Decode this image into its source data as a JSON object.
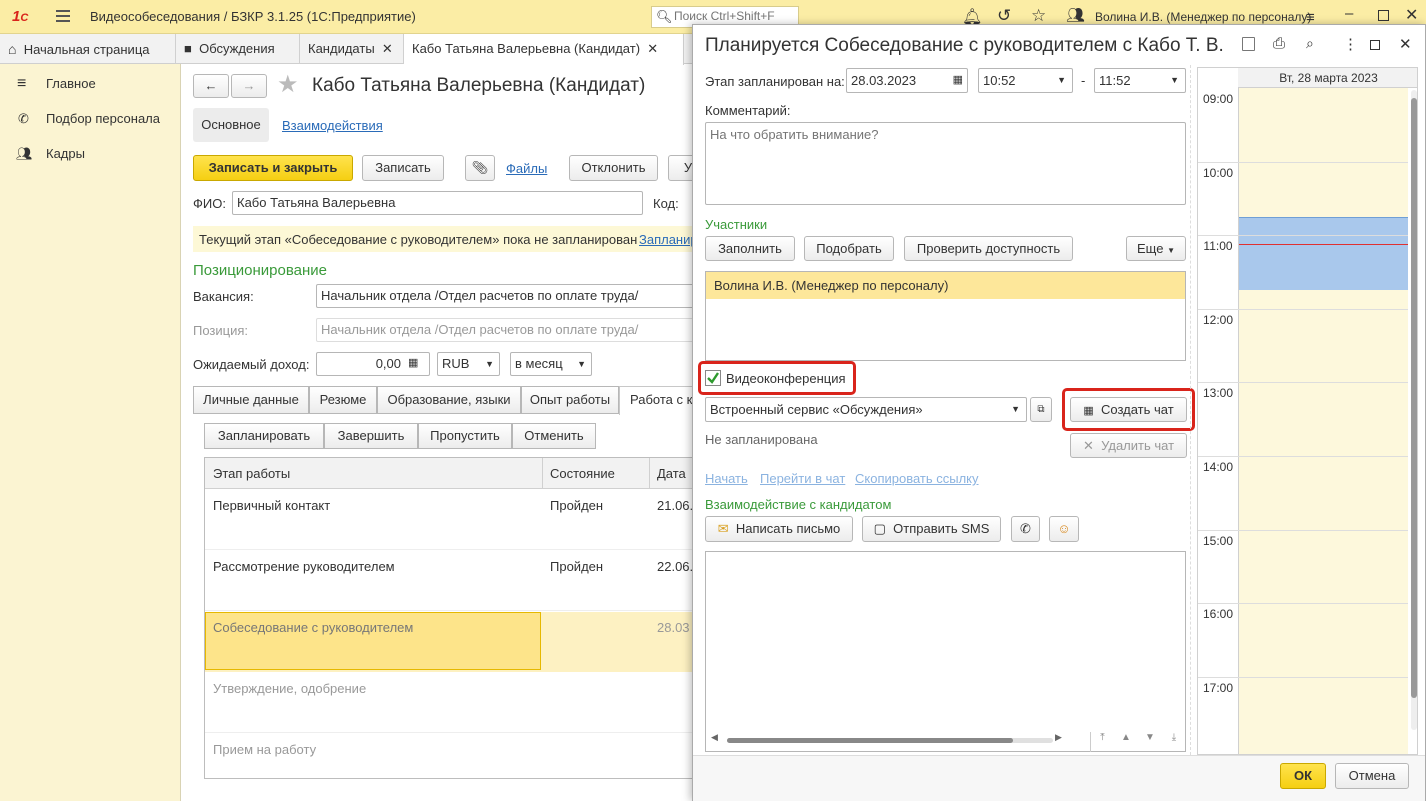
{
  "app": {
    "title": "Видеособеседования / БЗКР 3.1.25  (1С:Предприятие)",
    "search_placeholder": "Поиск Ctrl+Shift+F",
    "user": "Волина И.В. (Менеджер по персоналу)"
  },
  "tabs": [
    "Начальная страница",
    "Обсуждения",
    "Кандидаты",
    "Кабо Татьяна Валерьевна (Кандидат)"
  ],
  "sidebar": {
    "items": [
      "Главное",
      "Подбор персонала",
      "Кадры"
    ]
  },
  "candidate": {
    "title": "Кабо Татьяна Валерьевна (Кандидат)",
    "subtabs": [
      "Основное",
      "Взаимодействия"
    ],
    "buttons": {
      "save_close": "Записать и закрыть",
      "save": "Записать",
      "files": "Файлы",
      "reject": "Отклонить",
      "more": "У"
    },
    "fio_label": "ФИО:",
    "fio_value": "Кабо Татьяна Валерьевна",
    "code_label": "Код:",
    "notice": "Текущий этап «Собеседование с руководителем» пока не запланирован",
    "notice_link": "Запланир",
    "section_title": "Позиционирование",
    "vacancy_label": "Вакансия:",
    "vacancy_value": "Начальник отдела /Отдел расчетов по оплате труда/",
    "position_label": "Позиция:",
    "position_value": "Начальник отдела /Отдел расчетов по оплате труда/",
    "income_label": "Ожидаемый доход:",
    "income_value": "0,00",
    "currency": "RUB",
    "period": "в месяц",
    "page_tabs": [
      "Личные данные",
      "Резюме",
      "Образование, языки",
      "Опыт работы",
      "Работа с к"
    ],
    "table_buttons": [
      "Запланировать",
      "Завершить",
      "Пропустить",
      "Отменить"
    ],
    "table_headers": [
      "Этап работы",
      "Состояние",
      "Дата"
    ],
    "rows": [
      {
        "stage": "Первичный контакт",
        "state": "Пройден",
        "date": "21.06."
      },
      {
        "stage": "Рассмотрение руководителем",
        "state": "Пройден",
        "date": "22.06."
      },
      {
        "stage": "Собеседование с руководителем",
        "state": "",
        "date": "28.03"
      },
      {
        "stage": "Утверждение, одобрение",
        "state": "",
        "date": ""
      },
      {
        "stage": "Прием на работу",
        "state": "",
        "date": ""
      }
    ]
  },
  "dialog": {
    "title": "Планируется Собеседование с руководителем с Кабо Т. В.",
    "scheduled_label": "Этап запланирован на:",
    "date": "28.03.2023",
    "time_from": "10:52",
    "dash": "-",
    "time_to": "11:52",
    "comment_label": "Комментарий:",
    "comment_placeholder": "На что обратить внимание?",
    "participants_label": "Участники",
    "participant_buttons": [
      "Заполнить",
      "Подобрать",
      "Проверить доступность",
      "Еще"
    ],
    "participants": [
      "Волина И.В. (Менеджер по персоналу)"
    ],
    "video_label": "Видеоконференция",
    "video_checked": true,
    "service": "Встроенный сервис «Обсуждения»",
    "create_chat": "Создать чат",
    "delete_chat": "Удалить чат",
    "status": "Не запланирована",
    "links": [
      "Начать",
      "Перейти в чат",
      "Скопировать ссылку"
    ],
    "interaction_label": "Взаимодействие с кандидатом",
    "write_letter": "Написать письмо",
    "send_sms": "Отправить SMS",
    "ok": "ОК",
    "cancel": "Отмена"
  },
  "calendar": {
    "header": "Вт, 28 марта 2023",
    "hours": [
      "09:00",
      "10:00",
      "11:00",
      "12:00",
      "13:00",
      "14:00",
      "15:00",
      "16:00",
      "17:00"
    ],
    "event_start": "10:45",
    "event_end": "11:45",
    "current_time": "11:07",
    "colors": {
      "event": "#a9c8ec",
      "now_line": "#e03030",
      "grid_bg": "#fdf8dc"
    }
  },
  "colors": {
    "accent_yellow": "#f5cf12",
    "highlight_red": "#d9241b",
    "green_header": "#3a9a3a",
    "link_blue": "#2a6bb8"
  }
}
